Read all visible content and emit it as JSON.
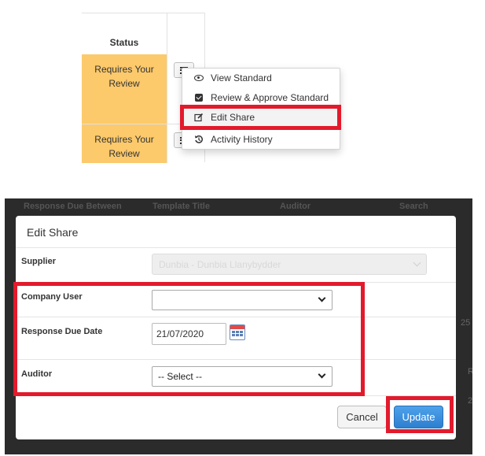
{
  "top": {
    "status_header": "Status",
    "rows": [
      {
        "status_line1": "Requires Your",
        "status_line2": "Review"
      },
      {
        "status_line1": "Requires Your",
        "status_line2": "Review"
      }
    ],
    "menu": {
      "items": [
        {
          "label": "View Standard",
          "icon": "eye-icon"
        },
        {
          "label": "Review & Approve Standard",
          "icon": "checkbox-icon"
        },
        {
          "label": "Edit Share",
          "icon": "edit-icon"
        },
        {
          "label": "Activity History",
          "icon": "history-icon"
        }
      ]
    }
  },
  "background": {
    "headers": [
      "Response Due Between",
      "Template Title",
      "Auditor",
      "Search"
    ],
    "fragments": [
      "25",
      "2",
      "R"
    ]
  },
  "modal": {
    "title": "Edit Share",
    "supplier": {
      "label": "Supplier",
      "value": "Dunbia - Dunbia Llanybydder"
    },
    "company_user": {
      "label": "Company User",
      "value": ""
    },
    "response_due_date": {
      "label": "Response Due Date",
      "value": "21/07/2020"
    },
    "auditor": {
      "label": "Auditor",
      "value": "-- Select --"
    },
    "buttons": {
      "cancel": "Cancel",
      "update": "Update"
    }
  },
  "colors": {
    "status_bg": "#fcc96b",
    "highlight": "#e21a2c",
    "update_button": "#2d7fd0"
  }
}
